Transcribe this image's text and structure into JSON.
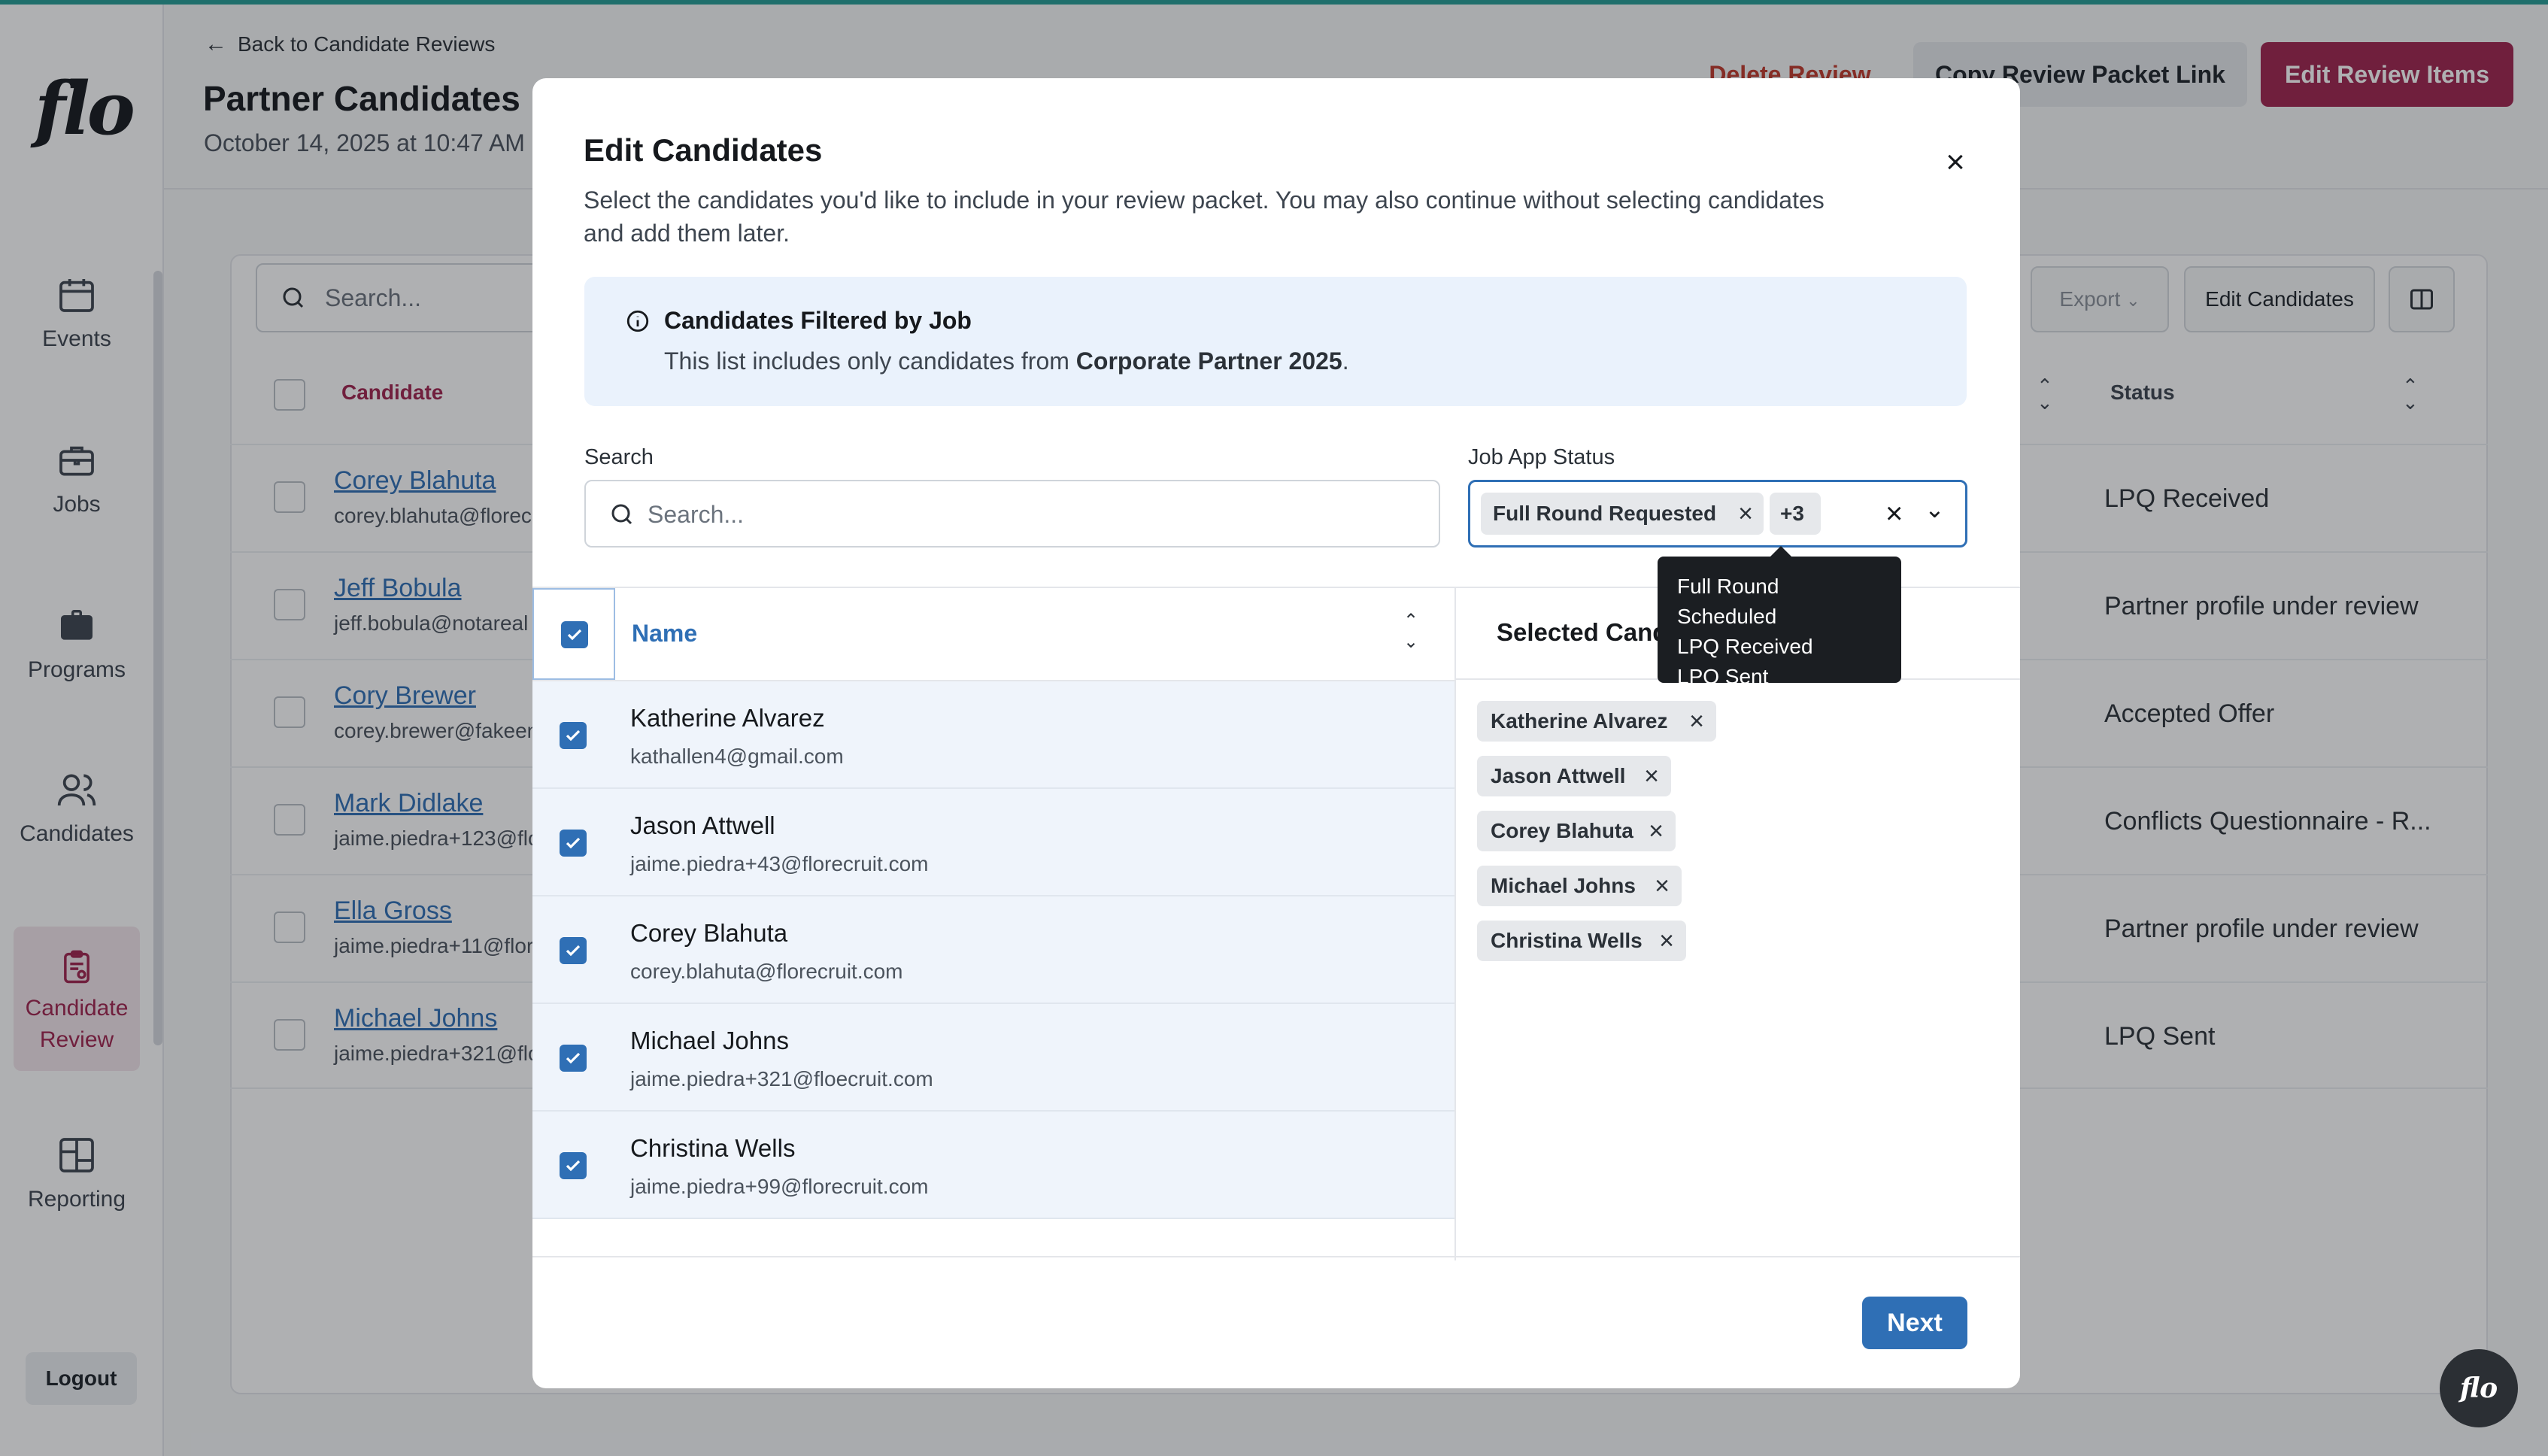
{
  "app": {
    "logo": "flo"
  },
  "sidebar": {
    "items": [
      {
        "label": "Events",
        "icon": "calendar-icon"
      },
      {
        "label": "Jobs",
        "icon": "briefcase-icon"
      },
      {
        "label": "Programs",
        "icon": "bag-icon"
      },
      {
        "label": "Candidates",
        "icon": "users-icon"
      },
      {
        "label_line1": "Candidate",
        "label_line2": "Review",
        "icon": "clipboard-icon",
        "active": true
      },
      {
        "label": "Reporting",
        "icon": "grid-icon"
      }
    ],
    "logout": "Logout"
  },
  "header": {
    "back": "Back to Candidate Reviews",
    "title": "Partner Candidates",
    "date": "October 14, 2025 at 10:47 AM",
    "delete_label": "Delete Review",
    "copy_label": "Copy Review Packet Link",
    "edit_label": "Edit Review Items"
  },
  "background_table": {
    "search_placeholder": "Search...",
    "export_label": "Export",
    "edit_candidates_label": "Edit Candidates",
    "col_candidate": "Candidate",
    "col_status": "Status",
    "rows": [
      {
        "name": "Corey Blahuta",
        "email": "corey.blahuta@florec",
        "status": "LPQ Received"
      },
      {
        "name": "Jeff Bobula",
        "email": "jeff.bobula@notareal",
        "status": "Partner profile under review"
      },
      {
        "name": "Cory Brewer",
        "email": "corey.brewer@fakeem",
        "status": "Accepted Offer"
      },
      {
        "name": "Mark Didlake",
        "email": "jaime.piedra+123@flo",
        "status": "Conflicts Questionnaire - R..."
      },
      {
        "name": "Ella Gross",
        "email": "jaime.piedra+11@flore",
        "status": "Partner profile under review"
      },
      {
        "name": "Michael Johns",
        "email": "jaime.piedra+321@flo",
        "status": "LPQ Sent"
      }
    ]
  },
  "modal": {
    "title": "Edit Candidates",
    "description": "Select the candidates you'd like to include in your review packet. You may also continue without selecting candidates and add them later.",
    "info_title": "Candidates Filtered by Job",
    "info_prefix": "This list includes only candidates from ",
    "info_job": "Corporate Partner 2025",
    "info_suffix": ".",
    "search_label": "Search",
    "search_placeholder": "Search...",
    "status_label": "Job App Status",
    "status_chip": "Full Round Requested",
    "status_more": "+3",
    "tooltip_items": [
      "Full Round Scheduled",
      "LPQ Received",
      "LPQ Sent"
    ],
    "name_header": "Name",
    "selected_header": "Selected Cand",
    "candidates": [
      {
        "name": "Katherine Alvarez",
        "email": "kathallen4@gmail.com"
      },
      {
        "name": "Jason Attwell",
        "email": "jaime.piedra+43@florecruit.com"
      },
      {
        "name": "Corey Blahuta",
        "email": "corey.blahuta@florecruit.com"
      },
      {
        "name": "Michael Johns",
        "email": "jaime.piedra+321@floecruit.com"
      },
      {
        "name": "Christina Wells",
        "email": "jaime.piedra+99@florecruit.com"
      }
    ],
    "selected": [
      "Katherine Alvarez",
      "Jason Attwell",
      "Corey Blahuta",
      "Michael Johns",
      "Christina Wells"
    ],
    "next_label": "Next"
  },
  "chat": {
    "label": "flo"
  }
}
